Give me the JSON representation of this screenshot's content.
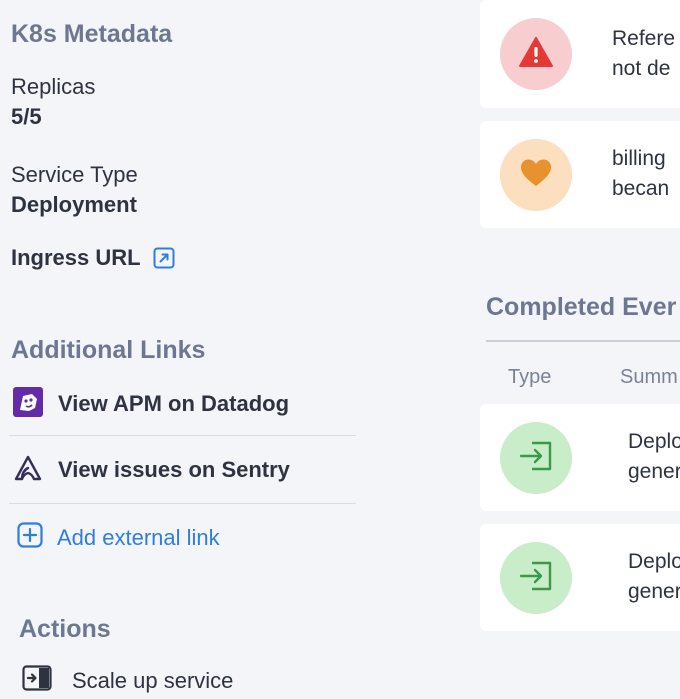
{
  "k8s": {
    "title": "K8s Metadata",
    "replicas_label": "Replicas",
    "replicas_value": "5/5",
    "service_type_label": "Service Type",
    "service_type_value": "Deployment",
    "ingress_label": "Ingress URL"
  },
  "links": {
    "title": "Additional Links",
    "items": [
      {
        "label": "View APM on Datadog",
        "icon": "datadog-icon"
      },
      {
        "label": "View issues on Sentry",
        "icon": "sentry-icon"
      }
    ],
    "add_label": "Add external link"
  },
  "actions": {
    "title": "Actions",
    "items": [
      {
        "label": "Scale up service",
        "icon": "scale-up-icon"
      }
    ]
  },
  "alerts": [
    {
      "line1": "Refere",
      "line2": "not de",
      "icon": "warning-icon",
      "color": "#e53935",
      "bg": "#f8cdd0"
    },
    {
      "line1": "billing",
      "line2": "becan",
      "icon": "heart-icon",
      "color": "#e8912f",
      "bg": "#fbdfbf"
    }
  ],
  "completed": {
    "title": "Completed Ever",
    "columns": [
      "Type",
      "Summ"
    ],
    "rows": [
      {
        "line1": "Deplo",
        "line2": "gener",
        "icon": "deploy-icon"
      },
      {
        "line1": "Deplo",
        "line2": "gener",
        "icon": "deploy-icon"
      }
    ],
    "icon_color": "#3a9a48",
    "icon_bg": "#c9ecc9"
  }
}
